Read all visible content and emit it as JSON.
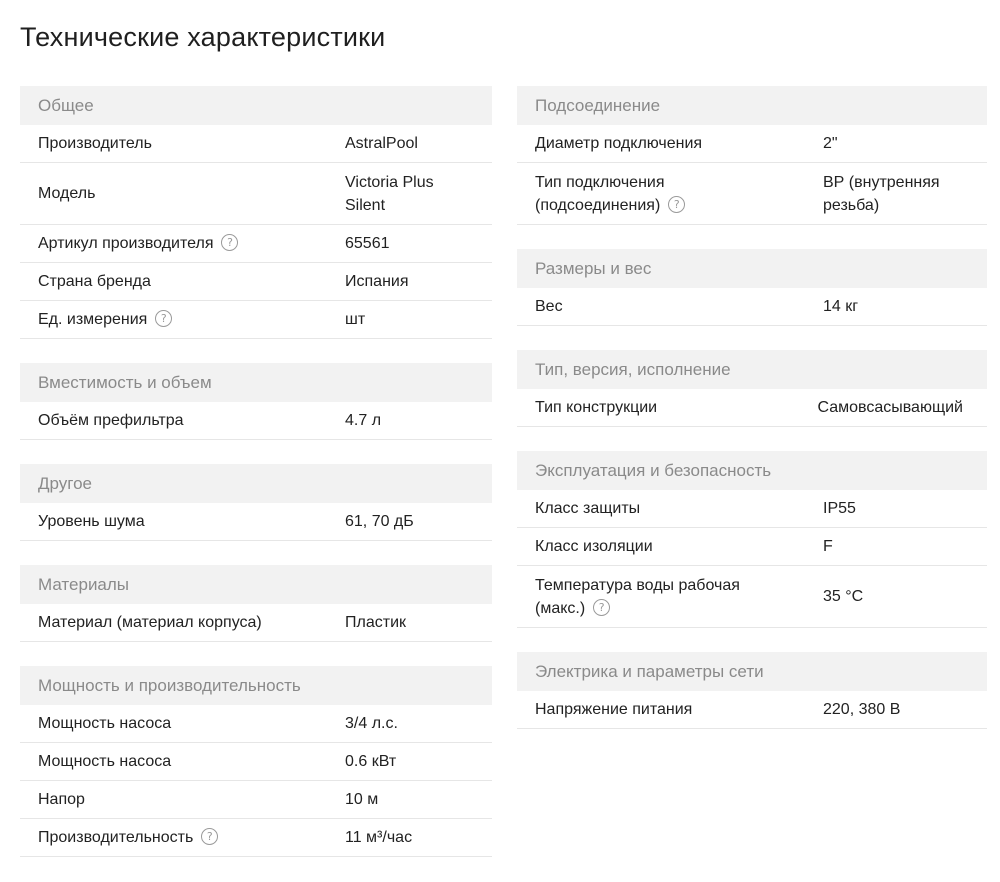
{
  "title": "Технические характеристики",
  "left_column": [
    {
      "header": "Общее",
      "rows": [
        {
          "name": "Производитель",
          "value": "AstralPool"
        },
        {
          "name": "Модель",
          "value": "Victoria Plus Silent"
        },
        {
          "name": "Артикул производителя",
          "value": "65561",
          "help": "?"
        },
        {
          "name": "Страна бренда",
          "value": "Испания"
        },
        {
          "name": "Ед. измерения",
          "value": "шт",
          "help": "?"
        }
      ]
    },
    {
      "header": "Вместимость и объем",
      "rows": [
        {
          "name": "Объём префильтра",
          "value": "4.7 л"
        }
      ]
    },
    {
      "header": "Другое",
      "rows": [
        {
          "name": "Уровень шума",
          "value": "61, 70 дБ"
        }
      ]
    },
    {
      "header": "Материалы",
      "rows": [
        {
          "name": "Материал (материал корпуса)",
          "value": "Пластик"
        }
      ]
    },
    {
      "header": "Мощность и производительность",
      "rows": [
        {
          "name": "Мощность насоса",
          "value": "3/4 л.с."
        },
        {
          "name": "Мощность насоса",
          "value": "0.6 кВт"
        },
        {
          "name": "Напор",
          "value": "10 м"
        },
        {
          "name": "Производительность",
          "value": "11 м³/час",
          "help": "?"
        }
      ]
    }
  ],
  "right_column": [
    {
      "header": "Подсоединение",
      "rows": [
        {
          "name": "Диаметр подключения",
          "value": "2\""
        },
        {
          "name": "Тип подключения (подсоединения)",
          "value": "ВР (внутренняя резьба)",
          "help": "?"
        }
      ]
    },
    {
      "header": "Размеры и вес",
      "rows": [
        {
          "name": "Вес",
          "value": "14 кг"
        }
      ]
    },
    {
      "header": "Тип, версия, исполнение",
      "rows": [
        {
          "name": "Тип конструкции",
          "value": "Самовсасывающий"
        }
      ]
    },
    {
      "header": "Эксплуатация и безопасность",
      "rows": [
        {
          "name": "Класс защиты",
          "value": "IP55"
        },
        {
          "name": "Класс изоляции",
          "value": "F"
        },
        {
          "name": "Температура воды рабочая (макс.)",
          "value": "35 °C",
          "help": "?"
        }
      ]
    },
    {
      "header": "Электрика и параметры сети",
      "rows": [
        {
          "name": "Напряжение питания",
          "value": "220, 380 В"
        }
      ]
    }
  ]
}
